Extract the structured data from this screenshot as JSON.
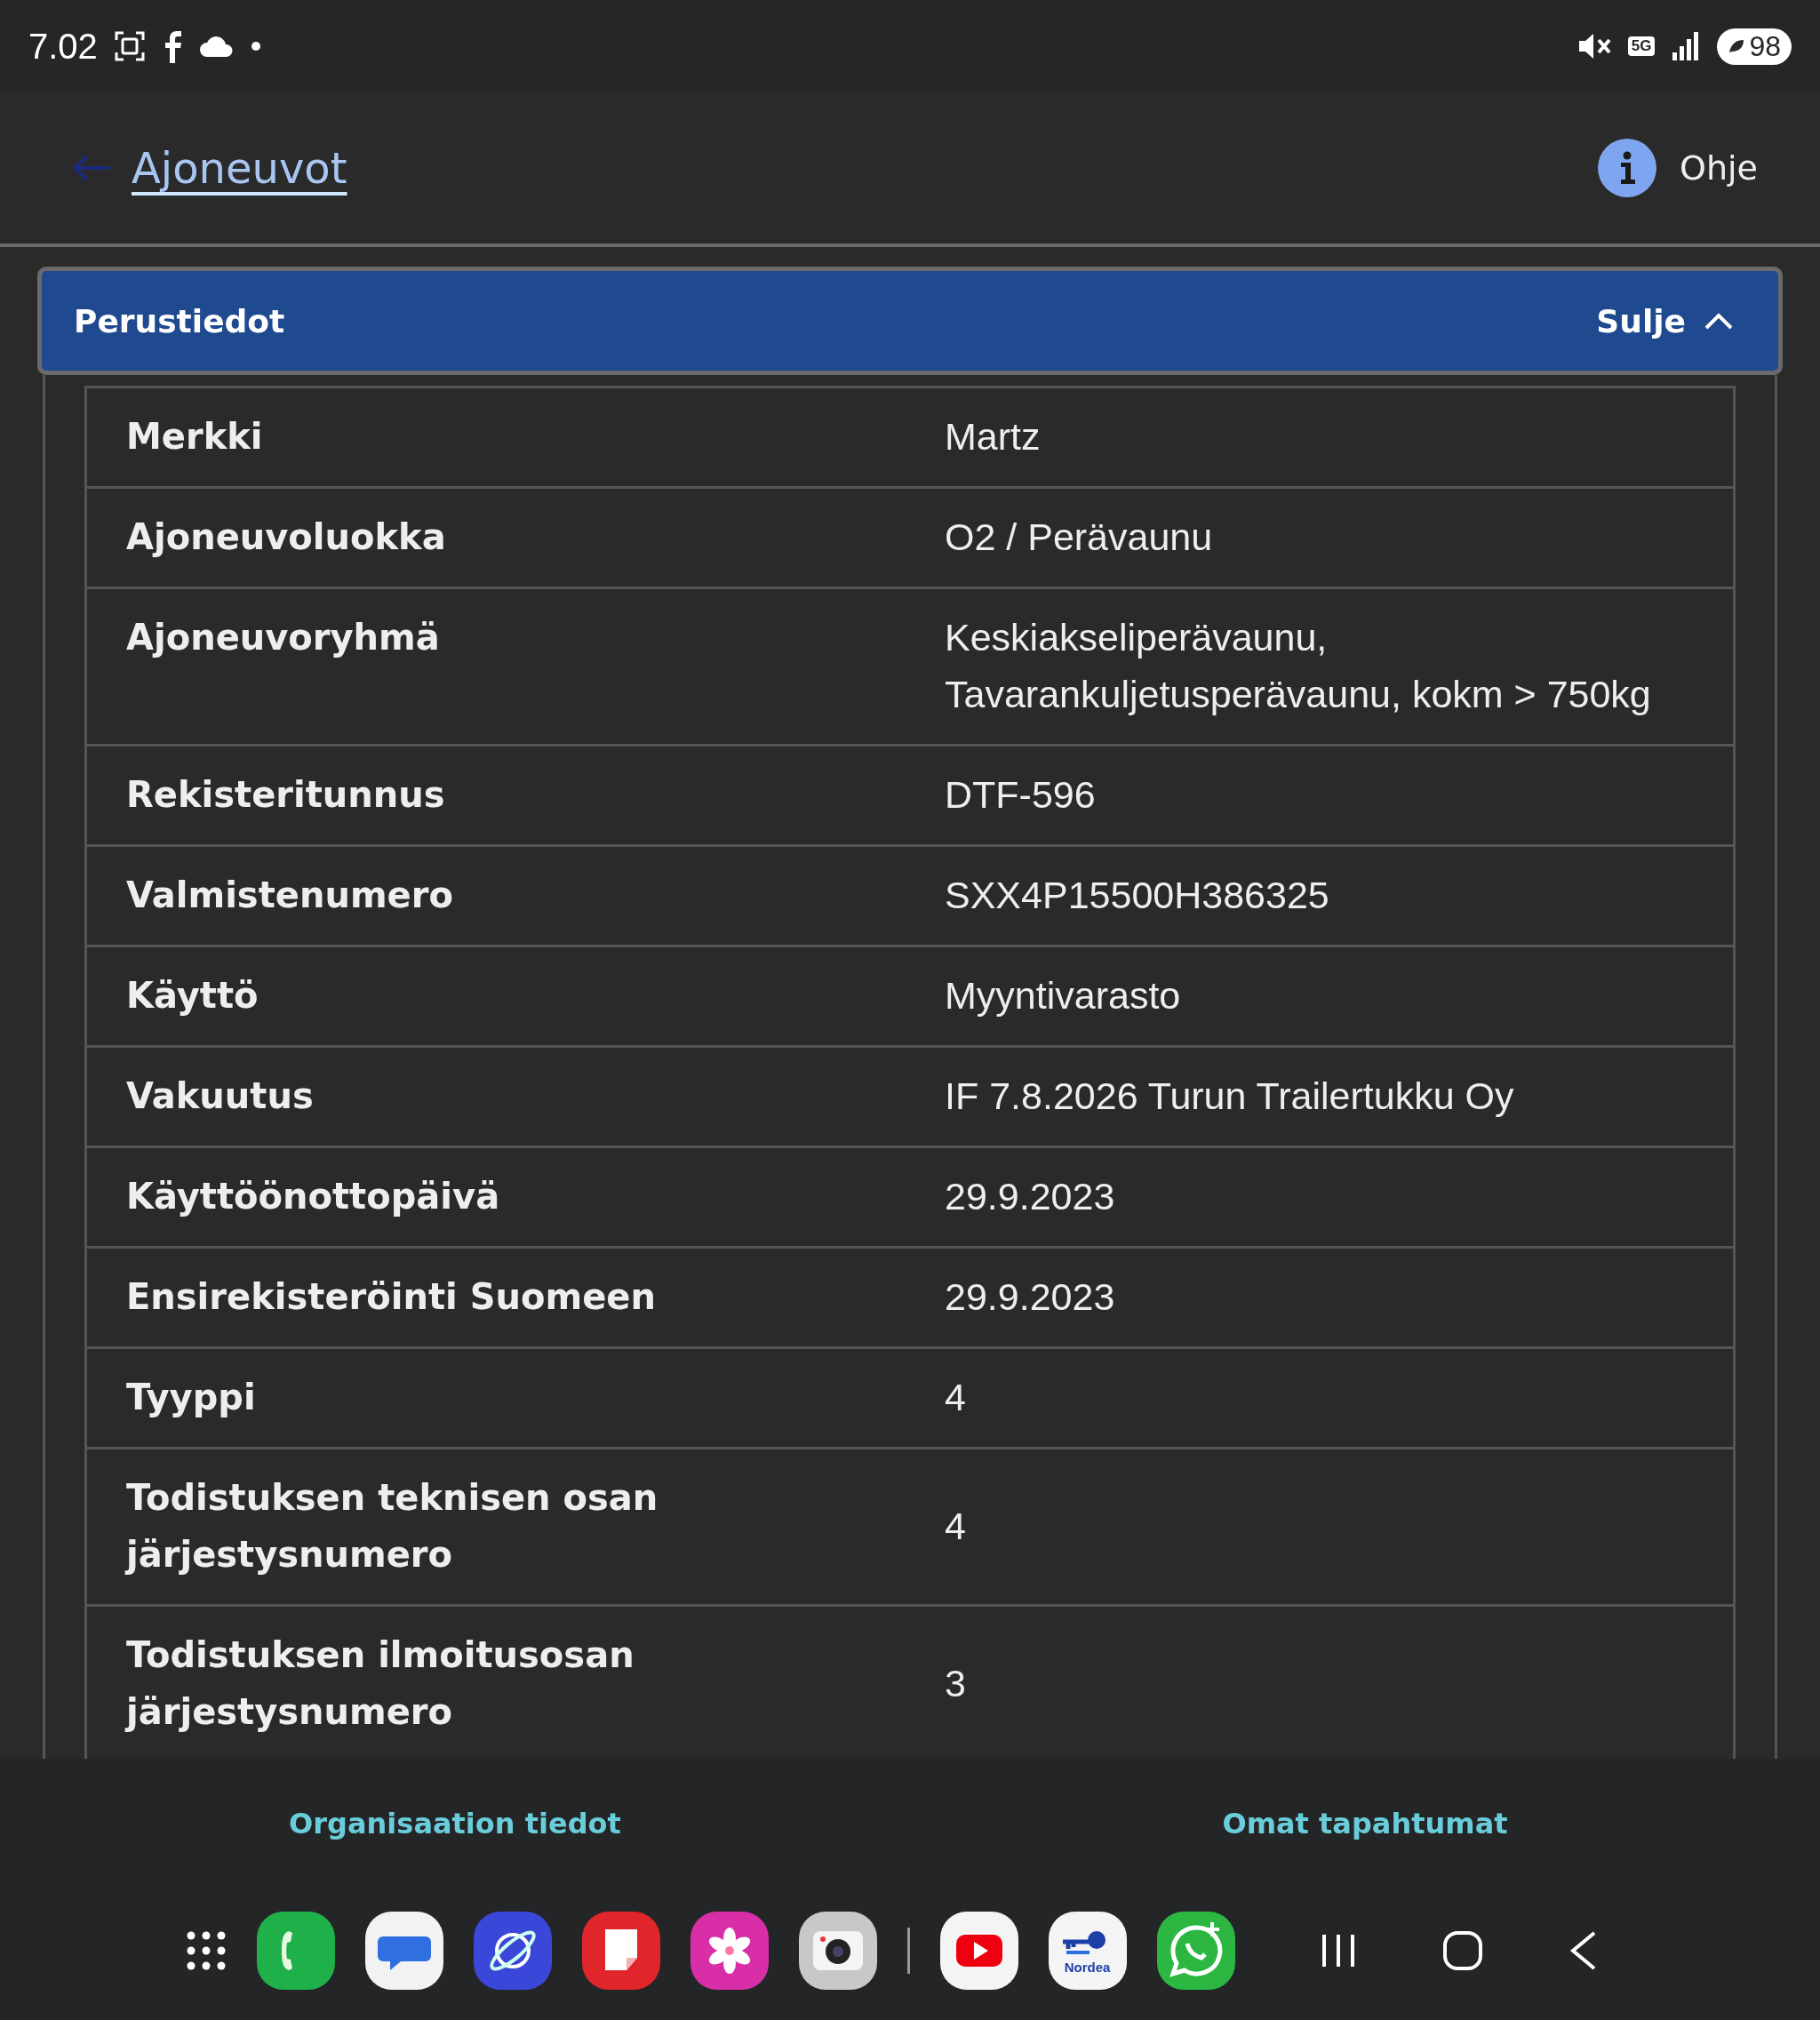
{
  "status_bar": {
    "time": "7.02",
    "network": "5G",
    "battery": "98"
  },
  "header": {
    "back_link": "Ajoneuvot",
    "help": "Ohje"
  },
  "section": {
    "title": "Perustiedot",
    "toggle": "Sulje",
    "expanded": true,
    "rows": [
      {
        "label": "Merkki",
        "value": "Martz"
      },
      {
        "label": "Ajoneuvoluokka",
        "value": "O2 / Perävaunu"
      },
      {
        "label": "Ajoneuvoryhmä",
        "value": "Keskiakseliperävaunu, Tavarankuljetusperävaunu, kokm > 750kg"
      },
      {
        "label": "Rekisteritunnus",
        "value": "DTF-596"
      },
      {
        "label": "Valmistenumero",
        "value": "SXX4P15500H386325"
      },
      {
        "label": "Käyttö",
        "value": "Myyntivarasto"
      },
      {
        "label": "Vakuutus",
        "value": "IF 7.8.2026 Turun Trailertukku Oy"
      },
      {
        "label": "Käyttöönottopäivä",
        "value": "29.9.2023"
      },
      {
        "label": "Ensirekisteröinti Suomeen",
        "value": "29.9.2023"
      },
      {
        "label": "Tyyppi",
        "value": "4"
      },
      {
        "label": "Todistuksen teknisen osan järjestysnumero",
        "value": "4"
      },
      {
        "label": "Todistuksen ilmoitusosan järjestysnumero",
        "value": "3"
      }
    ]
  },
  "bottom_nav": [
    {
      "label": "Organisaation tiedot"
    },
    {
      "label": "Omat tapahtumat"
    }
  ],
  "dock": [
    {
      "kind": "grid"
    },
    {
      "kind": "phone"
    },
    {
      "kind": "messages"
    },
    {
      "kind": "browser"
    },
    {
      "kind": "notes"
    },
    {
      "kind": "gallery"
    },
    {
      "kind": "camera"
    },
    {
      "kind": "divider"
    },
    {
      "kind": "video"
    },
    {
      "kind": "bank",
      "label": "Nordea"
    },
    {
      "kind": "chat"
    },
    {
      "kind": "recents"
    },
    {
      "kind": "home"
    },
    {
      "kind": "back"
    }
  ]
}
